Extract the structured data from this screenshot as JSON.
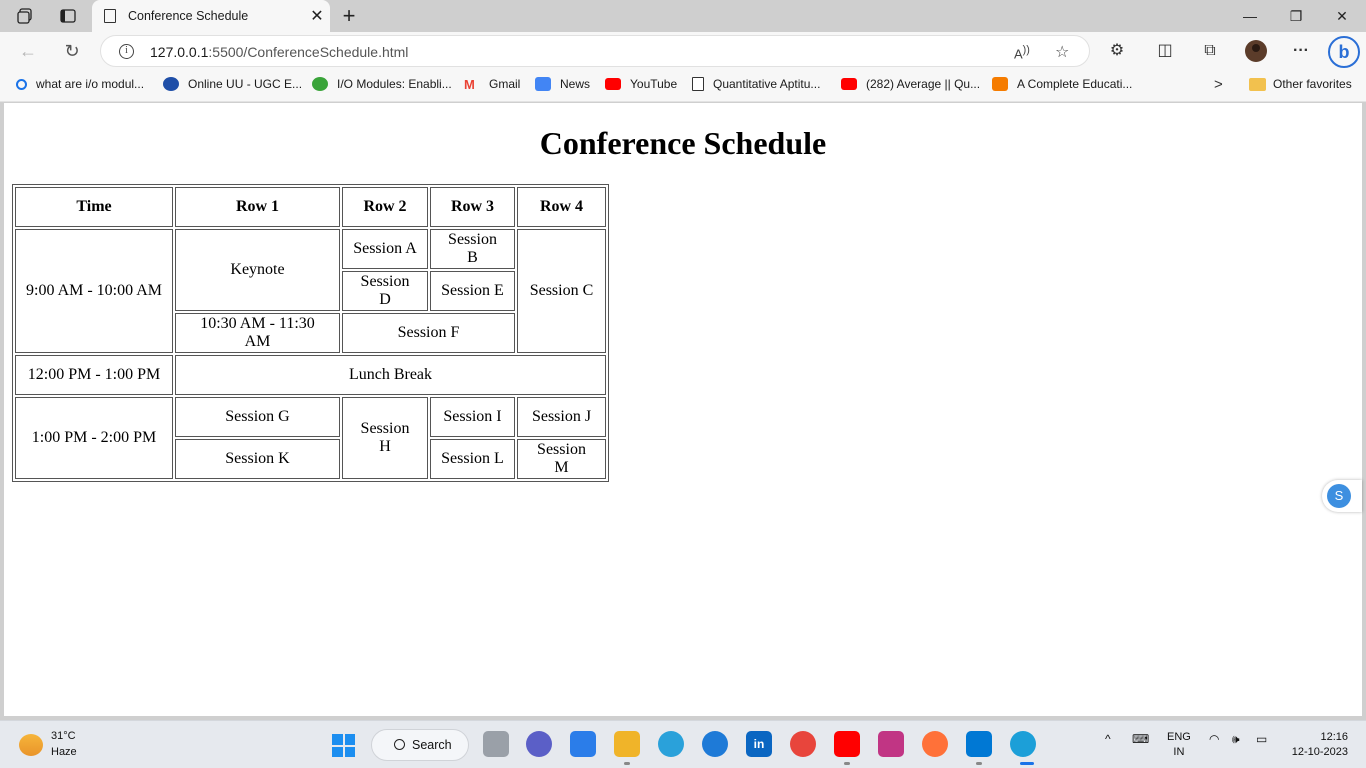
{
  "browser": {
    "tab_title": "Conference Schedule",
    "url_host": "127.0.0.1",
    "url_path": ":5500/ConferenceSchedule.html",
    "new_tab_glyph": "+",
    "close_glyph": "✕"
  },
  "favorites": [
    {
      "label": "what are i/o modul...",
      "icon": "search-icon",
      "color": "#1a73e8"
    },
    {
      "label": "Online UU - UGC E...",
      "icon": "uu-logo-icon",
      "color": "#1f4fa8"
    },
    {
      "label": "I/O Modules: Enabli...",
      "icon": "leaf-logo-icon",
      "color": "#3aa43a"
    },
    {
      "label": "Gmail",
      "icon": "gmail-icon",
      "color": "#ea4335"
    },
    {
      "label": "News",
      "icon": "news-icon",
      "color": "#4285f4"
    },
    {
      "label": "YouTube",
      "icon": "youtube-icon",
      "color": "#ff0000"
    },
    {
      "label": "Quantitative Aptitu...",
      "icon": "page-icon",
      "color": "#ffffff"
    },
    {
      "label": "(282) Average || Qu...",
      "icon": "youtube-icon",
      "color": "#ff0000"
    },
    {
      "label": "A Complete Educati...",
      "icon": "blogger-icon",
      "color": "#f57c00"
    }
  ],
  "other_favorites": "Other favorites",
  "page": {
    "title": "Conference Schedule",
    "headers": [
      "Time",
      "Row 1",
      "Row 2",
      "Row 3",
      "Row 4"
    ],
    "cells": {
      "t1": "9:00 AM - 10:00 AM",
      "keynote": "Keynote",
      "a": "Session A",
      "b": "Session B",
      "c": "Session C",
      "d": "Session D",
      "e": "Session E",
      "t2": "10:30 AM - 11:30 AM",
      "f": "Session F",
      "t3": "12:00 PM - 1:00 PM",
      "lunch": "Lunch Break",
      "t4": "1:00 PM - 2:00 PM",
      "g": "Session G",
      "h": "Session H",
      "i": "Session I",
      "j": "Session J",
      "k": "Session K",
      "l": "Session L",
      "m": "Session M"
    }
  },
  "sidebar_button_label": "S",
  "taskbar": {
    "temp": "31°C",
    "weather": "Haze",
    "search_label": "Search",
    "lang_top": "ENG",
    "lang_bottom": "IN",
    "time": "12:16",
    "date": "12-10-2023"
  }
}
